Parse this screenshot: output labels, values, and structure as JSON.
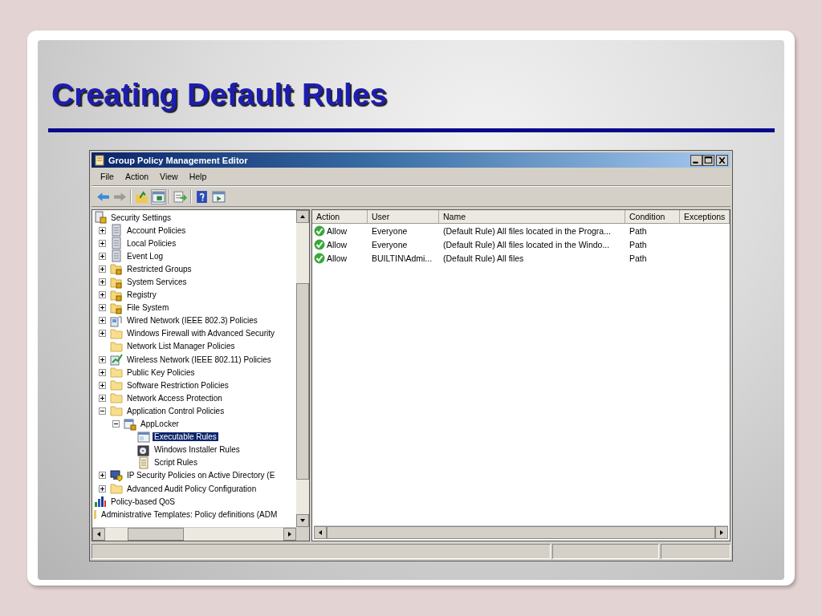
{
  "slide": {
    "title": "Creating Default Rules"
  },
  "window": {
    "title": "Group Policy Management Editor"
  },
  "menu": [
    "File",
    "Action",
    "View",
    "Help"
  ],
  "tree": {
    "items": [
      {
        "label": "Security Settings",
        "kind": "security",
        "selected": false,
        "children": [
          {
            "label": "Account Policies",
            "kind": "policy",
            "selected": false,
            "expanded": false
          },
          {
            "label": "Local Policies",
            "kind": "policy",
            "selected": false,
            "expanded": false
          },
          {
            "label": "Event Log",
            "kind": "policy",
            "selected": false,
            "expanded": false
          },
          {
            "label": "Restricted Groups",
            "kind": "locked-folder",
            "selected": false,
            "expanded": false
          },
          {
            "label": "System Services",
            "kind": "locked-folder",
            "selected": false,
            "expanded": false
          },
          {
            "label": "Registry",
            "kind": "locked-folder",
            "selected": false,
            "expanded": false
          },
          {
            "label": "File System",
            "kind": "locked-folder",
            "selected": false,
            "expanded": false
          },
          {
            "label": "Wired Network (IEEE 802.3) Policies",
            "kind": "network",
            "selected": false,
            "expanded": false
          },
          {
            "label": "Windows Firewall with Advanced Security",
            "kind": "folder",
            "selected": false,
            "expanded": false
          },
          {
            "label": "Network List Manager Policies",
            "kind": "folder",
            "selected": false
          },
          {
            "label": "Wireless Network (IEEE 802.11) Policies",
            "kind": "wireless",
            "selected": false,
            "expanded": false
          },
          {
            "label": "Public Key Policies",
            "kind": "folder",
            "selected": false,
            "expanded": false
          },
          {
            "label": "Software Restriction Policies",
            "kind": "folder",
            "selected": false,
            "expanded": false
          },
          {
            "label": "Network Access Protection",
            "kind": "folder",
            "selected": false,
            "expanded": false
          },
          {
            "label": "Application Control Policies",
            "kind": "folder",
            "selected": false,
            "expanded": true,
            "children": [
              {
                "label": "AppLocker",
                "kind": "applocker",
                "selected": false,
                "expanded": true,
                "children": [
                  {
                    "label": "Executable Rules",
                    "kind": "rules",
                    "selected": true
                  },
                  {
                    "label": "Windows Installer Rules",
                    "kind": "installer",
                    "selected": false
                  },
                  {
                    "label": "Script Rules",
                    "kind": "script",
                    "selected": false
                  }
                ]
              }
            ]
          },
          {
            "label": "IP Security Policies on Active Directory (E",
            "kind": "ip-security",
            "selected": false,
            "expanded": false
          },
          {
            "label": "Advanced Audit Policy Configuration",
            "kind": "folder",
            "selected": false,
            "expanded": false
          }
        ]
      },
      {
        "label": "Policy-based QoS",
        "kind": "chart",
        "selected": false
      },
      {
        "label": "Administrative Templates: Policy definitions (ADM",
        "kind": "template",
        "selected": false
      }
    ]
  },
  "table": {
    "columns": [
      "Action",
      "User",
      "Name",
      "Condition",
      "Exceptions"
    ],
    "rows": [
      {
        "action": "Allow",
        "user": "Everyone",
        "name": "(Default Rule) All files located in the Progra...",
        "condition": "Path",
        "selected": false
      },
      {
        "action": "Allow",
        "user": "Everyone",
        "name": "(Default Rule) All files located in the Windo...",
        "condition": "Path",
        "selected": false
      },
      {
        "action": "Allow",
        "user": "BUILTIN\\Admi...",
        "name": "(Default Rule) All files",
        "condition": "Path",
        "selected": false
      }
    ]
  }
}
